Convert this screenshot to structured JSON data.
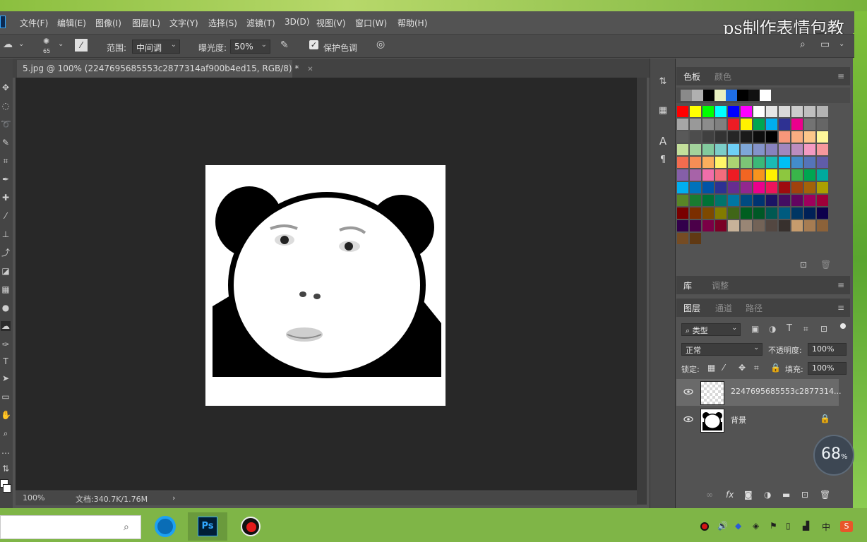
{
  "watermark": "ps制作表情包教",
  "menu": [
    "文件(F)",
    "编辑(E)",
    "图像(I)",
    "图层(L)",
    "文字(Y)",
    "选择(S)",
    "滤镜(T)",
    "3D(D)",
    "视图(V)",
    "窗口(W)",
    "帮助(H)"
  ],
  "options": {
    "brush_size": "65",
    "range_label": "范围:",
    "range_value": "中间调",
    "exposure_label": "曝光度:",
    "exposure_value": "50%",
    "protect_tones_label": "保护色调"
  },
  "document": {
    "tab_title": "5.jpg @ 100% (2247695685553c2877314af900b4ed15, RGB/8) *",
    "zoom": "100%",
    "doc_info": "文档:340.7K/1.76M"
  },
  "swatches_panel": {
    "tabs": [
      "色板",
      "颜色"
    ],
    "recent_colors": [
      "#8a8a8a",
      "#b0b0b0",
      "#000000",
      "#e8f0c0",
      "#1e6ee6",
      "#000000",
      "#111111",
      "#ffffff"
    ],
    "grid_colors": [
      [
        "#ff0000",
        "#ffff00",
        "#00ff00",
        "#00ffff",
        "#0000ff",
        "#ff00ff",
        "#ffffff",
        "#e6e6e6",
        "#d9d9d9",
        "#cccccc",
        "#bfbfbf",
        "#b3b3b3"
      ],
      [
        "#a6a6a6",
        "#999999",
        "#8c8c8c",
        "#808080",
        "#ed1c24",
        "#fff200",
        "#00a651",
        "#00aeef",
        "#2e3192",
        "#ec008c",
        "#737373",
        "#666666"
      ],
      [
        "#595959",
        "#4d4d4d",
        "#404040",
        "#333333",
        "#262626",
        "#1a1a1a",
        "#0d0d0d",
        "#000000",
        "#f7977a",
        "#f9ad81",
        "#fdc68a",
        "#fff79a"
      ],
      [
        "#c4df9b",
        "#a3d39c",
        "#82ca9d",
        "#7bcdc8",
        "#6ecff6",
        "#7ea7d8",
        "#8493ca",
        "#8882be",
        "#a187be",
        "#bc8dbf",
        "#f49ac2",
        "#f6989d"
      ],
      [
        "#f26c4f",
        "#f68e55",
        "#fbaf5d",
        "#fff568",
        "#acd372",
        "#7cc576",
        "#3bb878",
        "#1abbb4",
        "#00bff3",
        "#438cca",
        "#5574b9",
        "#605ca8"
      ],
      [
        "#855fa8",
        "#a763a8",
        "#f06ea9",
        "#f26d7d",
        "#ed1c24",
        "#f26522",
        "#f7941d",
        "#fff200",
        "#8dc73f",
        "#39b54a",
        "#00a651",
        "#00a99d"
      ],
      [
        "#00aeef",
        "#0072bc",
        "#0054a6",
        "#2e3192",
        "#662d91",
        "#92278f",
        "#ec008c",
        "#ed145b",
        "#9e0b0f",
        "#a0410d",
        "#a36209",
        "#aba000"
      ],
      [
        "#598527",
        "#1a7b30",
        "#007236",
        "#00746b",
        "#0076a3",
        "#004b80",
        "#003471",
        "#1b1464",
        "#440e62",
        "#630460",
        "#9e005d",
        "#9e0039"
      ],
      [
        "#790000",
        "#7b2e00",
        "#7d4900",
        "#827b00",
        "#406618",
        "#005e20",
        "#005826",
        "#005952",
        "#005b7f",
        "#003663",
        "#002157",
        "#0d004c"
      ],
      [
        "#32004b",
        "#4b0049",
        "#7b0046",
        "#7a0026",
        "#c7b299",
        "#998675",
        "#736357",
        "#534741",
        "#37302d",
        "#c69c6d",
        "#a67c52",
        "#8c6239"
      ],
      [
        "#754c24",
        "#603913"
      ]
    ]
  },
  "library_panel": {
    "tabs": [
      "库",
      "调整"
    ]
  },
  "layers_panel": {
    "tabs": [
      "图层",
      "通道",
      "路径"
    ],
    "filter_label": "类型",
    "blend_mode": "正常",
    "opacity_label": "不透明度:",
    "opacity_value": "100%",
    "lock_label": "锁定:",
    "fill_label": "填充:",
    "fill_value": "100%",
    "layers": [
      {
        "name": "2247695685553c2877314...",
        "selected": true
      },
      {
        "name": "背景",
        "locked": true
      }
    ]
  },
  "progress_widget": {
    "value": "68",
    "unit": "%"
  }
}
